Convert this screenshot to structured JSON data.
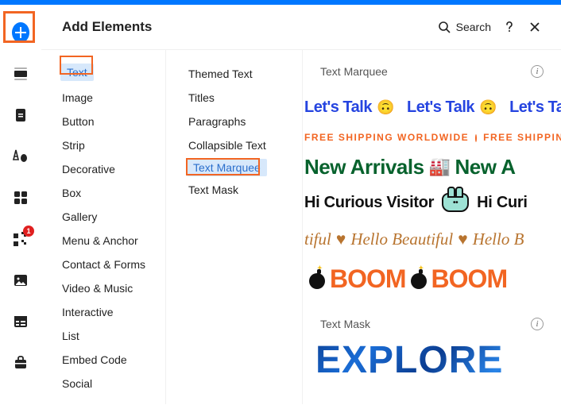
{
  "header": {
    "title": "Add Elements",
    "search_label": "Search"
  },
  "sidebar": {
    "badge_count": "1"
  },
  "categories": [
    {
      "label": "Text",
      "selected": true
    },
    {
      "label": "Image"
    },
    {
      "label": "Button"
    },
    {
      "label": "Strip"
    },
    {
      "label": "Decorative"
    },
    {
      "label": "Box"
    },
    {
      "label": "Gallery"
    },
    {
      "label": "Menu & Anchor"
    },
    {
      "label": "Contact & Forms"
    },
    {
      "label": "Video & Music"
    },
    {
      "label": "Interactive"
    },
    {
      "label": "List"
    },
    {
      "label": "Embed Code"
    },
    {
      "label": "Social"
    }
  ],
  "subcategories": [
    {
      "label": "Themed Text"
    },
    {
      "label": "Titles"
    },
    {
      "label": "Paragraphs"
    },
    {
      "label": "Collapsible Text"
    },
    {
      "label": "Text Marquee",
      "selected": true
    },
    {
      "label": "Text Mask"
    }
  ],
  "sections": {
    "marquee_title": "Text Marquee",
    "mask_title": "Text Mask"
  },
  "marquee_samples": {
    "lets_talk": "Let's Talk",
    "free_shipping": "FREE SHIPPING WORLDWIDE",
    "free_shipping_b": "FREE SHIPPIN",
    "new_arrivals": "New Arrivals",
    "new_arrivals_b": "New A",
    "curious": "Hi Curious Visitor",
    "curious_b": "Hi Curi",
    "hello_a": "tiful",
    "hello_b": "Hello Beautiful",
    "hello_c": "Hello B",
    "boom": "BOOM",
    "mask_preview": "EXPLORE"
  }
}
